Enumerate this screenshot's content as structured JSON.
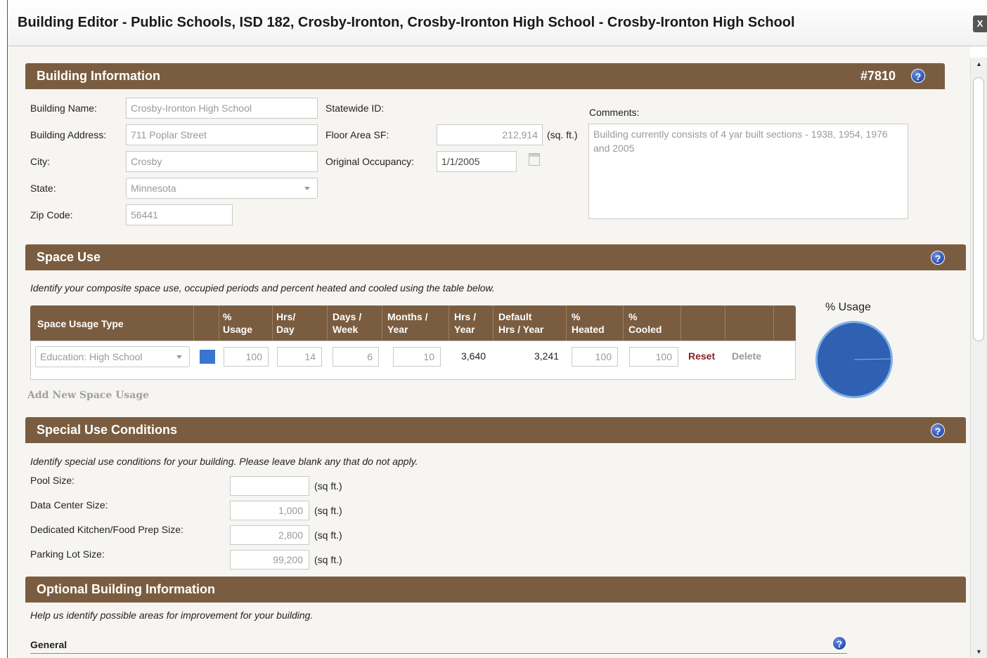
{
  "window": {
    "title": "Building Editor - Public Schools, ISD 182, Crosby-Ironton, Crosby-Ironton High School - Crosby-Ironton High School",
    "close_label": "X"
  },
  "building_info": {
    "header": "Building Information",
    "id": "#7810",
    "labels": {
      "name": "Building Name:",
      "address": "Building Address:",
      "city": "City:",
      "state": "State:",
      "zip": "Zip Code:",
      "statewide_id": "Statewide ID:",
      "floor_area": "Floor Area SF:",
      "floor_area_unit": "(sq. ft.)",
      "original_occupancy": "Original Occupancy:",
      "comments": "Comments:"
    },
    "values": {
      "name": "Crosby-Ironton High School",
      "address": "711 Poplar Street",
      "city": "Crosby",
      "state": "Minnesota",
      "zip": "56441",
      "floor_area": "212,914",
      "original_occupancy": "1/1/2005",
      "comments": "Building currently consists of 4 yar built sections - 1938, 1954, 1976 and 2005"
    }
  },
  "space_use": {
    "header": "Space Use",
    "description": "Identify your composite space use, occupied periods and percent heated and cooled using the table below.",
    "columns": {
      "type": "Space Usage Type",
      "usage_1": "%",
      "usage_2": "Usage",
      "hrs_day_1": "Hrs/",
      "hrs_day_2": "Day",
      "days_week_1": "Days /",
      "days_week_2": "Week",
      "months_year_1": "Months /",
      "months_year_2": "Year",
      "hrs_year_1": "Hrs /",
      "hrs_year_2": "Year",
      "default_1": "Default",
      "default_2": "Hrs / Year",
      "heated_1": "%",
      "heated_2": "Heated",
      "cooled_1": "%",
      "cooled_2": "Cooled"
    },
    "row": {
      "type": "Education: High School",
      "swatch_color": "#3a76d0",
      "usage": "100",
      "hrs_day": "14",
      "days_week": "6",
      "months_year": "10",
      "hrs_year": "3,640",
      "default_hrs_year": "3,241",
      "heated": "100",
      "cooled": "100",
      "reset": "Reset",
      "delete": "Delete"
    },
    "add_link": "Add New Space Usage",
    "chart_title": "% Usage"
  },
  "chart_data": {
    "type": "pie",
    "title": "% Usage",
    "categories": [
      "Education: High School"
    ],
    "values": [
      100
    ],
    "colors": [
      "#3a76d0"
    ]
  },
  "special_use": {
    "header": "Special Use Conditions",
    "description": "Identify special use conditions for your building. Please leave blank any that do not apply.",
    "unit": "(sq ft.)",
    "rows": [
      {
        "label": "Pool Size:",
        "value": ""
      },
      {
        "label": "Data Center Size:",
        "value": "1,000"
      },
      {
        "label": "Dedicated Kitchen/Food Prep Size:",
        "value": "2,800"
      },
      {
        "label": "Parking Lot Size:",
        "value": "99,200"
      }
    ]
  },
  "optional_info": {
    "header": "Optional Building Information",
    "description": "Help us identify possible areas for improvement for your building.",
    "general": "General"
  },
  "colors": {
    "section_header": "#7a5d40",
    "content_bg": "#f6f5f1",
    "reset_link": "#8b2020"
  }
}
